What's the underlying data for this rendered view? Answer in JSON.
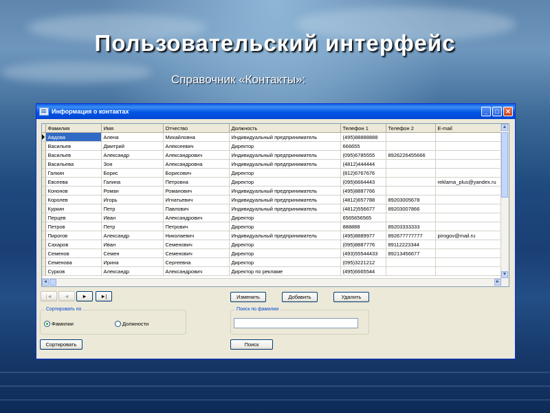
{
  "slide": {
    "title": "Пользовательский интерфейс",
    "subtitle": "Справочник «Контакты»:"
  },
  "window": {
    "title": "Информация о контактах",
    "controls": [
      "_",
      "□",
      "✕"
    ]
  },
  "grid": {
    "columns": [
      "Фамилия",
      "Имя",
      "Отчество",
      "Должность",
      "Телефон 1",
      "Телефон 2",
      "E-mail"
    ],
    "rows": [
      [
        "Авдова",
        "Алена",
        "Михайловна",
        "Индивидуальный предприниматель",
        "(495)88888888",
        "",
        ""
      ],
      [
        "Васильев",
        "Дмитрий",
        "Алексеевич",
        "Директор",
        "666655",
        "",
        ""
      ],
      [
        "Васильев",
        "Александр",
        "Александрович",
        "Индивидуальный предприниматель",
        "(095)6785555",
        "8926226455666",
        ""
      ],
      [
        "Васильева",
        "Зоя",
        "Александровна",
        "Индивидуальный предприниматель",
        "(4812)444444",
        "",
        ""
      ],
      [
        "Галкин",
        "Борис",
        "Борисович",
        "Директор",
        "(812)6767676",
        "",
        ""
      ],
      [
        "Евсеева",
        "Галина",
        "Петровна",
        "Директор",
        "(095)6664443",
        "",
        "reklama_plus@yandex.ru"
      ],
      [
        "Кононов",
        "Роман",
        "Романович",
        "Индивидуальный предприниматель",
        "(495)8887766",
        "",
        ""
      ],
      [
        "Королев",
        "Игорь",
        "Игнатьевич",
        "Индивидуальный предприниматель",
        "(4812)657788",
        "89203005678",
        ""
      ],
      [
        "Куркин",
        "Петр",
        "Павлович",
        "Индивидуальный предприниматель",
        "(4812)556677",
        "89203007866",
        ""
      ],
      [
        "Перцев",
        "Иван",
        "Александрович",
        "Директор",
        "6565656565",
        "",
        ""
      ],
      [
        "Петров",
        "Петр",
        "Петрович",
        "Директор",
        "888888",
        "89203333333",
        ""
      ],
      [
        "Пирогов",
        "Александр",
        "Николаевич",
        "Индивидуальный предприниматель",
        "(495)8889977",
        "892677777777",
        "pirogov@mail.ru"
      ],
      [
        "Сахаров",
        "Иван",
        "Семенович",
        "Директор",
        "(095)8887776",
        "89112223344",
        ""
      ],
      [
        "Семенов",
        "Семен",
        "Семенович",
        "Директор",
        "(493)55544433",
        "89213456677",
        ""
      ],
      [
        "Семенова",
        "Ирина",
        "Сергеевна",
        "Директор",
        "(095)3221212",
        "",
        ""
      ],
      [
        "Сурков",
        "Александр",
        "Александрович",
        "Директор по рекламе",
        "(495)6665544",
        "",
        ""
      ]
    ]
  },
  "nav": {
    "first": "|◄",
    "prev": "◄",
    "next": "►",
    "last": "►|"
  },
  "actions": {
    "edit": "Изменить",
    "add": "Добавить",
    "delete": "Удалить"
  },
  "sort": {
    "group_label": "Сортировать по",
    "option_surname": "Фамилии",
    "option_position": "Должности",
    "selected": "Фамилии",
    "button": "Сортировать"
  },
  "search": {
    "group_label": "Поиск по фамилии",
    "value": "",
    "button": "Поиск"
  }
}
